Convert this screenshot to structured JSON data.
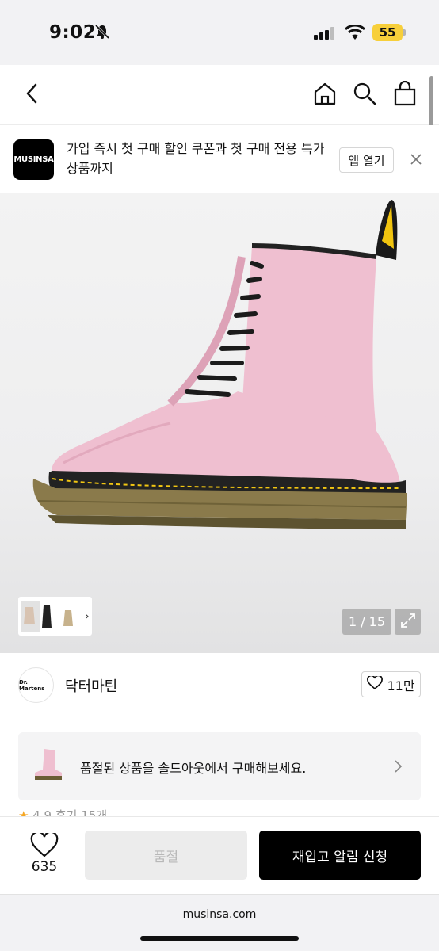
{
  "status_bar": {
    "time": "9:02",
    "battery": "55"
  },
  "banner": {
    "logo_text": "MUSINSA",
    "message": "가입 즉시 첫 구매 할인 쿠폰과 첫 구매 전용 특가 상품까지",
    "open_app_label": "앱 열기"
  },
  "gallery": {
    "counter": "1 / 15"
  },
  "brand": {
    "name": "닥터마틴",
    "logo_text": "Dr. Martens",
    "likes": "11만"
  },
  "soldout_card": {
    "text": "품절된 상품을 솔드아웃에서 구매해보세요."
  },
  "rating_peek": {
    "score": "4.9",
    "reviews": "후기 15개"
  },
  "bottom_bar": {
    "wish_count": "635",
    "soldout_label": "품절",
    "restock_label": "재입고 알림 신청"
  },
  "browser": {
    "url": "musinsa.com"
  },
  "colors": {
    "accent": "#000000",
    "battery": "#f7cf3a",
    "star": "#f5a623"
  },
  "icons": [
    "bell-off-icon",
    "signal-icon",
    "wifi-icon",
    "back-icon",
    "home-icon",
    "search-icon",
    "bag-icon",
    "close-icon",
    "expand-icon",
    "heart-icon",
    "chevron-right-icon"
  ]
}
